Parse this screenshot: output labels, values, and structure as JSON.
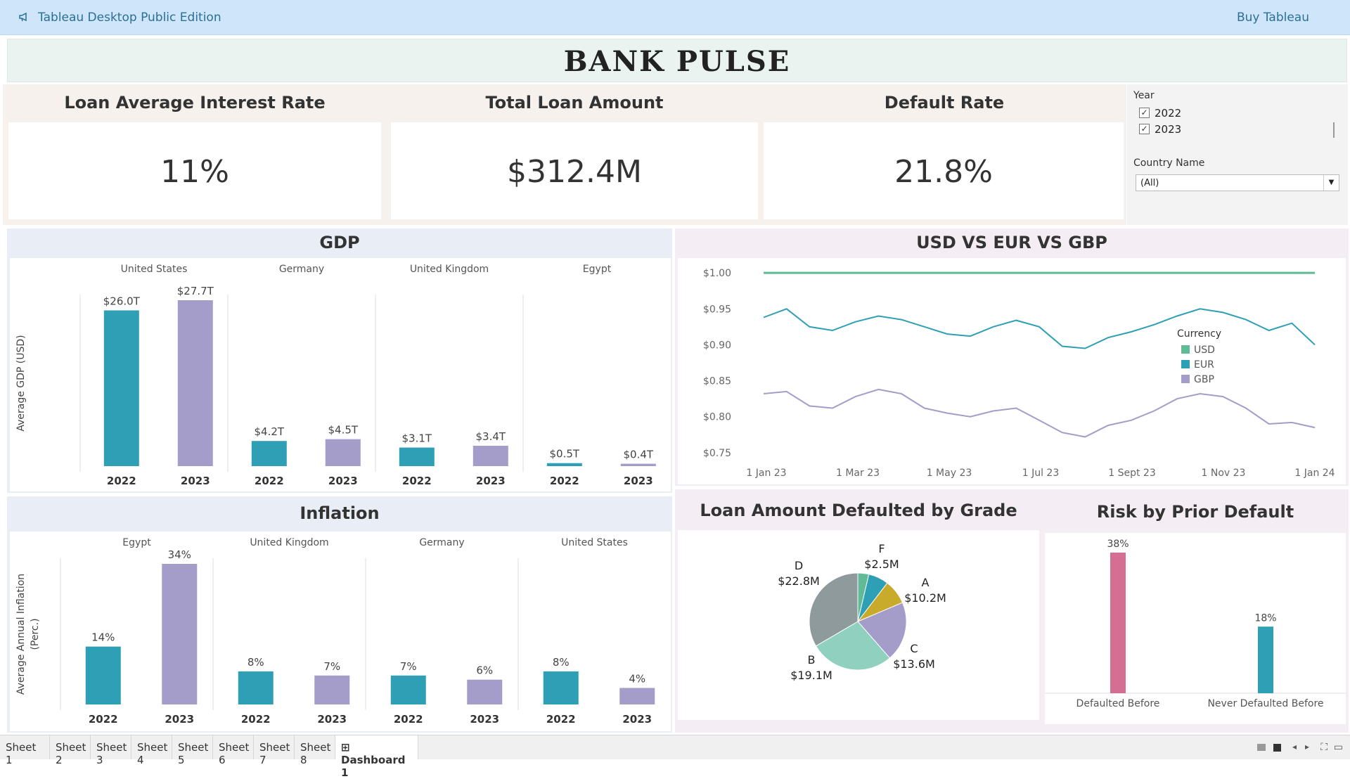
{
  "app": {
    "title": "Tableau Desktop Public Edition",
    "buy_label": "Buy Tableau"
  },
  "dashboard": {
    "title": "BANK PULSE"
  },
  "kpis": [
    {
      "title": "Loan Average Interest Rate",
      "value": "11%"
    },
    {
      "title": "Total Loan Amount",
      "value": "$312.4M"
    },
    {
      "title": "Default Rate",
      "value": "21.8%"
    }
  ],
  "filters": {
    "year_label": "Year",
    "years": [
      {
        "label": "2022",
        "checked": true
      },
      {
        "label": "2023",
        "checked": true
      }
    ],
    "country_label": "Country Name",
    "country_value": "(All)"
  },
  "tabs": [
    "Sheet 1",
    "Sheet 2",
    "Sheet 3",
    "Sheet 4",
    "Sheet 5",
    "Sheet 6",
    "Sheet 7",
    "Sheet 8",
    "Dashboard 1"
  ],
  "active_tab": "Dashboard 1",
  "colors": {
    "teal": "#2e9fb4",
    "purple": "#a49cc9",
    "green": "#5fba95",
    "pink": "#d46e93",
    "grey": "#8e9a9b",
    "gold": "#c8ab2b",
    "mint": "#8fd0bf"
  },
  "chart_data": [
    {
      "type": "bar",
      "title": "GDP",
      "ylabel": "Average GDP (USD)",
      "panels": [
        "United States",
        "Germany",
        "United Kingdom",
        "Egypt"
      ],
      "categories": [
        "2022",
        "2023"
      ],
      "values_trillions": [
        [
          26.0,
          27.7
        ],
        [
          4.2,
          4.5
        ],
        [
          3.1,
          3.4
        ],
        [
          0.5,
          0.4
        ]
      ],
      "labels": [
        [
          "$26.0T",
          "$27.7T"
        ],
        [
          "$4.2T",
          "$4.5T"
        ],
        [
          "$3.1T",
          "$3.4T"
        ],
        [
          "$0.5T",
          "$0.4T"
        ]
      ]
    },
    {
      "type": "bar",
      "title": "Inflation",
      "ylabel": "Average Annual Inflation (Perc.)",
      "panels": [
        "Egypt",
        "United Kingdom",
        "Germany",
        "United States"
      ],
      "categories": [
        "2022",
        "2023"
      ],
      "values": [
        [
          14,
          34
        ],
        [
          8,
          7
        ],
        [
          7,
          6
        ],
        [
          8,
          4
        ]
      ],
      "labels": [
        [
          "14%",
          "34%"
        ],
        [
          "8%",
          "7%"
        ],
        [
          "7%",
          "6%"
        ],
        [
          "8%",
          "4%"
        ]
      ]
    },
    {
      "type": "line",
      "title": "USD VS EUR VS GBP",
      "legend_title": "Currency",
      "x_ticks": [
        "1 Jan 23",
        "1 Mar 23",
        "1 May 23",
        "1 Jul 23",
        "1 Sept 23",
        "1 Nov 23",
        "1 Jan 24"
      ],
      "y_ticks": [
        "$1.00",
        "$0.95",
        "$0.90",
        "$0.85",
        "$0.80",
        "$0.75"
      ],
      "ylim": [
        0.745,
        1.005
      ],
      "series": [
        {
          "name": "USD",
          "values": [
            1.0,
            1.0,
            1.0,
            1.0,
            1.0,
            1.0,
            1.0,
            1.0,
            1.0,
            1.0,
            1.0,
            1.0,
            1.0,
            1.0,
            1.0,
            1.0,
            1.0,
            1.0,
            1.0,
            1.0,
            1.0,
            1.0,
            1.0,
            1.0,
            1.0
          ]
        },
        {
          "name": "EUR",
          "values": [
            0.938,
            0.95,
            0.925,
            0.92,
            0.932,
            0.94,
            0.935,
            0.925,
            0.915,
            0.912,
            0.925,
            0.934,
            0.925,
            0.898,
            0.895,
            0.91,
            0.918,
            0.928,
            0.94,
            0.95,
            0.945,
            0.935,
            0.92,
            0.93,
            0.9
          ]
        },
        {
          "name": "GBP",
          "values": [
            0.832,
            0.835,
            0.815,
            0.812,
            0.828,
            0.838,
            0.832,
            0.812,
            0.805,
            0.8,
            0.808,
            0.812,
            0.795,
            0.778,
            0.772,
            0.788,
            0.795,
            0.808,
            0.825,
            0.832,
            0.828,
            0.812,
            0.79,
            0.792,
            0.785
          ]
        }
      ]
    },
    {
      "type": "pie",
      "title": "Loan Amount Defaulted by Grade",
      "slices": [
        {
          "label": "A",
          "value": 10.2,
          "text": "$10.2M"
        },
        {
          "label": "B",
          "value": 19.1,
          "text": "$19.1M"
        },
        {
          "label": "C",
          "value": 13.6,
          "text": "$13.6M"
        },
        {
          "label": "D",
          "value": 22.8,
          "text": "$22.8M"
        },
        {
          "label": "F",
          "value": 2.5,
          "text": "$2.5M"
        }
      ]
    },
    {
      "type": "bar",
      "title": "Risk by Prior Default",
      "categories": [
        "Defaulted Before",
        "Never Defaulted Before"
      ],
      "values": [
        38,
        18
      ],
      "labels": [
        "38%",
        "18%"
      ]
    }
  ]
}
